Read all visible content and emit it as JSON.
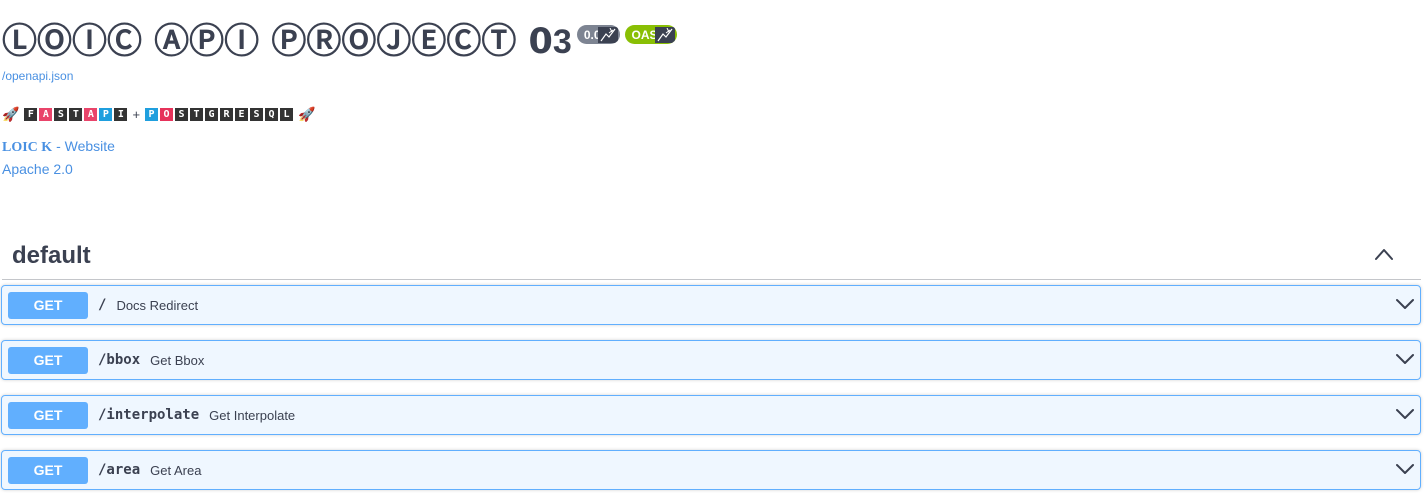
{
  "info": {
    "title": "ⓁⓄⒾⒸ ⒶⓅⒾ ⓅⓇⓄⒿⒺⒸⓉ 0",
    "title_tail": "3",
    "version_badge": "0.0",
    "oas_badge": "OAS",
    "openapi_url": "/openapi.json",
    "banner": {
      "rocket": "🚀",
      "fastapi_letters": [
        "F",
        "A",
        "S",
        "T",
        "A",
        "P",
        "I"
      ],
      "plus": "+",
      "postgres_letters": [
        "P",
        "O",
        "S",
        "T",
        "G",
        "R",
        "E",
        "S",
        "Q",
        "L"
      ]
    },
    "contact_name": "LOIC K",
    "contact_suffix": " - Website",
    "license": "Apache 2.0"
  },
  "tag": {
    "name": "default"
  },
  "operations": [
    {
      "method": "GET",
      "path": "/",
      "summary": "Docs Redirect"
    },
    {
      "method": "GET",
      "path": "/bbox",
      "summary": "Get Bbox"
    },
    {
      "method": "GET",
      "path": "/interpolate",
      "summary": "Get Interpolate"
    },
    {
      "method": "GET",
      "path": "/area",
      "summary": "Get Area"
    }
  ],
  "colors": {
    "get_accent": "#61affe",
    "link": "#4990e2",
    "oas_green": "#89bf04",
    "version_grey": "#7d8492"
  }
}
